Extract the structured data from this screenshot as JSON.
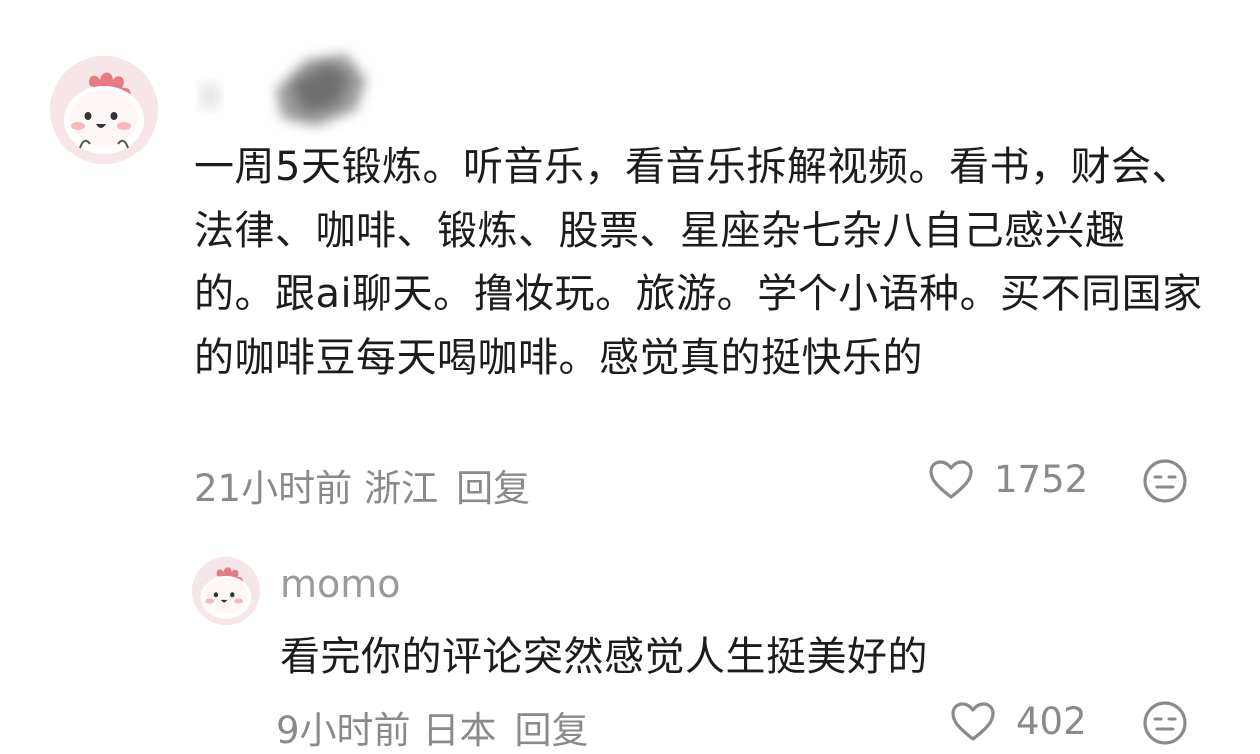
{
  "comment": {
    "username": "",
    "text": "一周5天锻炼。听音乐，看音乐拆解视频。看书，财会、法律、咖啡、锻炼、股票、星座杂七杂八自己感兴趣的。跟ai聊天。撸妆玩。旅游。学个小语种。买不同国家的咖啡豆每天喝咖啡。感觉真的挺快乐的",
    "time": "21小时前",
    "location": "浙江",
    "reply_label": "回复",
    "likes": "1752",
    "avatar_icon": "cute-pink-creature-avatar"
  },
  "reply": {
    "username": "momo",
    "text": "看完你的评论突然感觉人生挺美好的",
    "time": "9小时前",
    "location": "日本",
    "reply_label": "回复",
    "likes": "402",
    "avatar_icon": "cute-pink-creature-avatar"
  },
  "colors": {
    "text": "#1c1c1c",
    "meta": "#8a8a8a",
    "avatar_bg": "#f6e6e8",
    "avatar_crest": "#e77b84"
  }
}
